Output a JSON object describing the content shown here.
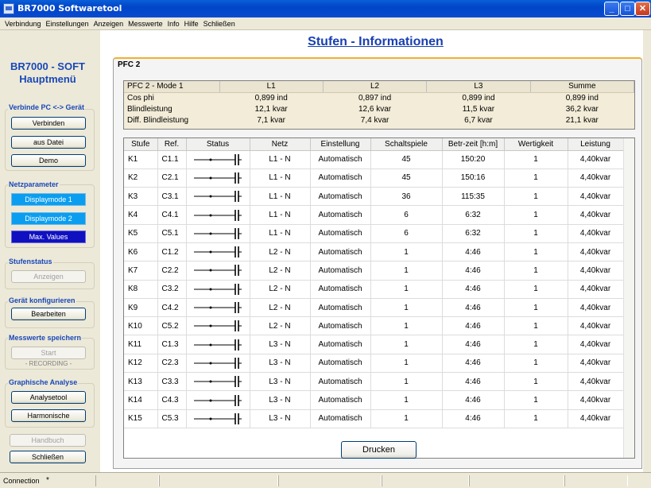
{
  "window": {
    "title": "BR7000 Softwaretool",
    "minimize": "_",
    "maximize": "□",
    "close": "✕"
  },
  "menu": [
    "Verbindung",
    "Einstellungen",
    "Anzeigen",
    "Messwerte",
    "Info",
    "Hilfe",
    "Schließen"
  ],
  "sidebar": {
    "title_line1": "BR7000 - SOFT",
    "title_line2": "Hauptmenü",
    "connect": {
      "label": "Verbinde PC <-> Gerät",
      "buttons": [
        "Verbinden",
        "aus Datei",
        "Demo"
      ]
    },
    "netzparameter": {
      "label": "Netzparameter",
      "buttons": [
        "Displaymode 1",
        "Displaymode 2",
        "Max. Values"
      ]
    },
    "stufenstatus": {
      "label": "Stufenstatus",
      "button": "Anzeigen"
    },
    "konfig": {
      "label": "Gerät konfigurieren",
      "button": "Bearbeiten"
    },
    "speichern": {
      "label": "Messwerte speichern",
      "button": "Start",
      "note": "- RECORDING -"
    },
    "analyse": {
      "label": "Graphische Analyse",
      "buttons": [
        "Analysetool",
        "Harmonische"
      ]
    },
    "handbuch": "Handbuch",
    "schliessen": "Schließen"
  },
  "main": {
    "title": "Stufen - Informationen",
    "panel_title": "PFC 2",
    "summary": {
      "headers": [
        "PFC 2 - Mode 1",
        "L1",
        "L2",
        "L3",
        "Summe"
      ],
      "rows": [
        [
          "Cos phi",
          "0,899 ind",
          "0,897 ind",
          "0,899 ind",
          "0,899 ind"
        ],
        [
          "Blindleistung",
          "12,1 kvar",
          "12,6 kvar",
          "11,5 kvar",
          "36,2 kvar"
        ],
        [
          "Diff. Blindleistung",
          "7,1 kvar",
          "7,4 kvar",
          "6,7 kvar",
          "21,1 kvar"
        ]
      ]
    },
    "table": {
      "headers": [
        "Stufe",
        "Ref.",
        "Status",
        "Netz",
        "Einstellung",
        "Schaltspiele",
        "Betr-zeit [h:m]",
        "Wertigkeit",
        "Leistung"
      ],
      "rows": [
        [
          "K1",
          "C1.1",
          "L1 - N",
          "Automatisch",
          "45",
          "150:20",
          "1",
          "4,40kvar"
        ],
        [
          "K2",
          "C2.1",
          "L1 - N",
          "Automatisch",
          "45",
          "150:16",
          "1",
          "4,40kvar"
        ],
        [
          "K3",
          "C3.1",
          "L1 - N",
          "Automatisch",
          "36",
          "115:35",
          "1",
          "4,40kvar"
        ],
        [
          "K4",
          "C4.1",
          "L1 - N",
          "Automatisch",
          "6",
          "6:32",
          "1",
          "4,40kvar"
        ],
        [
          "K5",
          "C5.1",
          "L1 - N",
          "Automatisch",
          "6",
          "6:32",
          "1",
          "4,40kvar"
        ],
        [
          "K6",
          "C1.2",
          "L2 - N",
          "Automatisch",
          "1",
          "4:46",
          "1",
          "4,40kvar"
        ],
        [
          "K7",
          "C2.2",
          "L2 - N",
          "Automatisch",
          "1",
          "4:46",
          "1",
          "4,40kvar"
        ],
        [
          "K8",
          "C3.2",
          "L2 - N",
          "Automatisch",
          "1",
          "4:46",
          "1",
          "4,40kvar"
        ],
        [
          "K9",
          "C4.2",
          "L2 - N",
          "Automatisch",
          "1",
          "4:46",
          "1",
          "4,40kvar"
        ],
        [
          "K10",
          "C5.2",
          "L2 - N",
          "Automatisch",
          "1",
          "4:46",
          "1",
          "4,40kvar"
        ],
        [
          "K11",
          "C1.3",
          "L3 - N",
          "Automatisch",
          "1",
          "4:46",
          "1",
          "4,40kvar"
        ],
        [
          "K12",
          "C2.3",
          "L3 - N",
          "Automatisch",
          "1",
          "4:46",
          "1",
          "4,40kvar"
        ],
        [
          "K13",
          "C3.3",
          "L3 - N",
          "Automatisch",
          "1",
          "4:46",
          "1",
          "4,40kvar"
        ],
        [
          "K14",
          "C4.3",
          "L3 - N",
          "Automatisch",
          "1",
          "4:46",
          "1",
          "4,40kvar"
        ],
        [
          "K15",
          "C5.3",
          "L3 - N",
          "Automatisch",
          "1",
          "4:46",
          "1",
          "4,40kvar"
        ]
      ]
    },
    "print_button": "Drucken"
  },
  "statusbar": {
    "text": "Connection",
    "indicator": "*"
  },
  "colors": {
    "title_blue": "#1940b0",
    "display_mode_active": "#0b9ef0",
    "max_values": "#1010c0",
    "panel_accent": "#f0b030"
  },
  "icons": {
    "status": "capacitor-switch-icon",
    "app": "app-icon"
  }
}
